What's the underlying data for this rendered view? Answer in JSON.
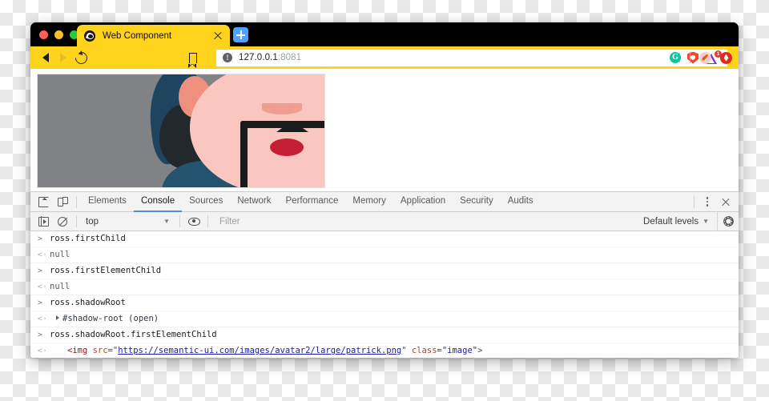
{
  "window": {
    "traffic_lights": [
      "close",
      "minimize",
      "maximize"
    ]
  },
  "tab": {
    "title": "Web Component",
    "favicon": "globe-icon",
    "close_label": "",
    "newtab_label": "+"
  },
  "toolbar": {
    "back": "back-arrow-icon",
    "forward": "forward-arrow-icon",
    "reload": "reload-icon",
    "bookmark": "bookmark-icon",
    "url_host": "127.0.0.1",
    "url_port": ":8081",
    "security_icon": "info-circle-icon",
    "shield_icon": "brave-shield-icon",
    "warning_icon": "warning-triangle-icon",
    "warning_badge": "1",
    "grammarly_icon": "G",
    "extension_icon": "rocket-icon",
    "rewards_icon": "brave-rewards-icon"
  },
  "viewport": {
    "image_alt": "avatar illustration"
  },
  "devtools": {
    "tabs": [
      {
        "label": "Elements",
        "active": false
      },
      {
        "label": "Console",
        "active": true
      },
      {
        "label": "Sources",
        "active": false
      },
      {
        "label": "Network",
        "active": false
      },
      {
        "label": "Performance",
        "active": false
      },
      {
        "label": "Memory",
        "active": false
      },
      {
        "label": "Application",
        "active": false
      },
      {
        "label": "Security",
        "active": false
      },
      {
        "label": "Audits",
        "active": false
      }
    ],
    "inspect_icon": "inspect-element-icon",
    "device_icon": "device-toolbar-icon",
    "more_icon": "kebab-menu-icon",
    "close_icon": "close-icon",
    "filterbar": {
      "sidebar_toggle": "console-sidebar-icon",
      "clear_console": "clear-console-icon",
      "context": "top",
      "eye_icon": "live-expression-icon",
      "filter_placeholder": "Filter",
      "levels": "Default levels",
      "settings_icon": "gear-icon"
    },
    "console_rows": [
      {
        "kind": "input",
        "marker": ">",
        "text": "ross.firstChild"
      },
      {
        "kind": "result",
        "marker": "<·",
        "text": "null",
        "style": "value"
      },
      {
        "kind": "input",
        "marker": ">",
        "text": "ross.firstElementChild"
      },
      {
        "kind": "result",
        "marker": "<·",
        "text": "null",
        "style": "value"
      },
      {
        "kind": "input",
        "marker": ">",
        "text": "ross.shadowRoot"
      },
      {
        "kind": "result",
        "marker": "<·",
        "text": "#shadow-root (open)",
        "style": "shadow",
        "expandable": true
      },
      {
        "kind": "input",
        "marker": ">",
        "text": "ross.shadowRoot.firstElementChild"
      },
      {
        "kind": "result",
        "marker": "<·",
        "style": "markup",
        "tokens": [
          {
            "t": "<img ",
            "c": "tag"
          },
          {
            "t": "src",
            "c": "attr"
          },
          {
            "t": "=\"",
            "c": "punct"
          },
          {
            "t": "https://semantic-ui.com/images/avatar2/large/patrick.png",
            "c": "link"
          },
          {
            "t": "\" ",
            "c": "punct"
          },
          {
            "t": "class",
            "c": "attr"
          },
          {
            "t": "=",
            "c": "punct"
          },
          {
            "t": "\"image\"",
            "c": "val"
          },
          {
            "t": ">",
            "c": "punct"
          }
        ]
      },
      {
        "kind": "prompt",
        "marker": ">",
        "text": ""
      }
    ]
  },
  "colors": {
    "brand_yellow": "#ffd21c",
    "titlebar_black": "#000000",
    "accent_blue": "#4a90e2",
    "link_blue": "#1a1aa6",
    "tag_red": "#a31515"
  }
}
